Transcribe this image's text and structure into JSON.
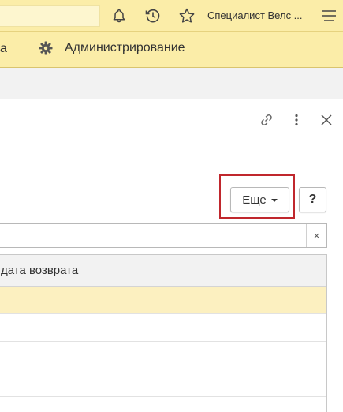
{
  "topbar": {
    "search_value": "",
    "user_name": "Специалист Велс ...",
    "icons": [
      "bell-icon",
      "history-icon",
      "star-icon",
      "menu-icon"
    ]
  },
  "sections": {
    "partial_label": "а",
    "admin_label": "Администрирование",
    "admin_icon": "gear-icon"
  },
  "window_tools": [
    "link-icon",
    "more-vertical-icon",
    "close-icon"
  ],
  "command_bar": {
    "more_label": "Еще",
    "help_label": "?"
  },
  "search": {
    "value": "",
    "clear_label": "×"
  },
  "table": {
    "columns": [
      "дата возврата"
    ],
    "rows": [
      {
        "selected": true,
        "value": ""
      },
      {
        "selected": false,
        "value": ""
      },
      {
        "selected": false,
        "value": ""
      },
      {
        "selected": false,
        "value": ""
      }
    ]
  },
  "colors": {
    "topbar_bg": "#fbeda8",
    "highlight_border": "#c0272d",
    "selected_row": "#fcf0c0"
  }
}
